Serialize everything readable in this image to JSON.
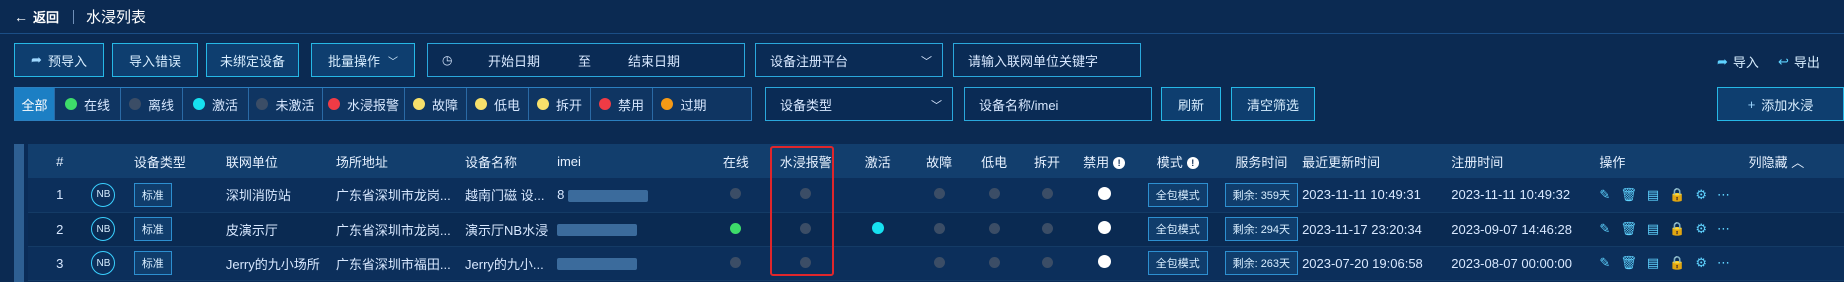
{
  "titlebar": {
    "back_label": "返回",
    "title": "水浸列表"
  },
  "toolbar": {
    "pre_import": "预导入",
    "import_error": "导入错误",
    "unbound": "未绑定设备",
    "batch_ops": "批量操作",
    "date_start": "开始日期",
    "date_to": "至",
    "date_end": "结束日期",
    "platform_placeholder": "设备注册平台",
    "unit_placeholder": "请输入联网单位关键字",
    "import": "导入",
    "export": "导出"
  },
  "filters": {
    "segments": [
      {
        "label": "全部",
        "color": "",
        "active": true
      },
      {
        "label": "在线",
        "color": "#3ddc6a"
      },
      {
        "label": "离线",
        "color": "#3b4d66"
      },
      {
        "label": "激活",
        "color": "#16e1f0"
      },
      {
        "label": "未激活",
        "color": "#3b4d66"
      },
      {
        "label": "水浸报警",
        "color": "#ef3b45"
      },
      {
        "label": "故障",
        "color": "#f7e06b"
      },
      {
        "label": "低电",
        "color": "#f7e06b"
      },
      {
        "label": "拆开",
        "color": "#f7e06b"
      },
      {
        "label": "禁用",
        "color": "#ef3b45"
      },
      {
        "label": "过期",
        "color": "#f59a16"
      }
    ],
    "device_type_placeholder": "设备类型",
    "device_name_placeholder": "设备名称/imei",
    "refresh": "刷新",
    "clear": "清空筛选",
    "add": "添加水浸"
  },
  "table": {
    "headers": {
      "index": "#",
      "type": "设备类型",
      "unit": "联网单位",
      "address": "场所地址",
      "name": "设备名称",
      "imei": "imei",
      "online": "在线",
      "alarm": "水浸报警",
      "active": "激活",
      "fault": "故障",
      "lowbat": "低电",
      "open": "拆开",
      "disabled": "禁用",
      "mode": "模式",
      "service": "服务时间",
      "updated": "最近更新时间",
      "registered": "注册时间",
      "ops": "操作",
      "hide": "列隐藏"
    },
    "rows": [
      {
        "index": "1",
        "badge": "NB",
        "type": "标准",
        "unit": "深圳消防站",
        "address": "广东省深圳市龙岗...",
        "name": "越南门磁 设...",
        "imei_prefix": "8",
        "online_color": "#3b4d66",
        "active_color": "",
        "mode": "全包模式",
        "service": "剩余: 359天",
        "updated": "2023-11-11 10:49:31",
        "registered": "2023-11-11 10:49:32"
      },
      {
        "index": "2",
        "badge": "NB",
        "type": "标准",
        "unit": "皮演示厅",
        "address": "广东省深圳市龙岗...",
        "name": "演示厅NB水浸",
        "imei_prefix": "",
        "online_color": "#3ddc6a",
        "active_color": "#16e1f0",
        "mode": "全包模式",
        "service": "剩余: 294天",
        "updated": "2023-11-17 23:20:34",
        "registered": "2023-09-07 14:46:28"
      },
      {
        "index": "3",
        "badge": "NB",
        "type": "标准",
        "unit": "Jerry的九小场所",
        "address": "广东省深圳市福田...",
        "name": "Jerry的九小...",
        "imei_prefix": "",
        "online_color": "#3b4d66",
        "active_color": "",
        "mode": "全包模式",
        "service": "剩余: 263天",
        "updated": "2023-07-20 19:06:58",
        "registered": "2023-08-07 00:00:00"
      }
    ]
  }
}
